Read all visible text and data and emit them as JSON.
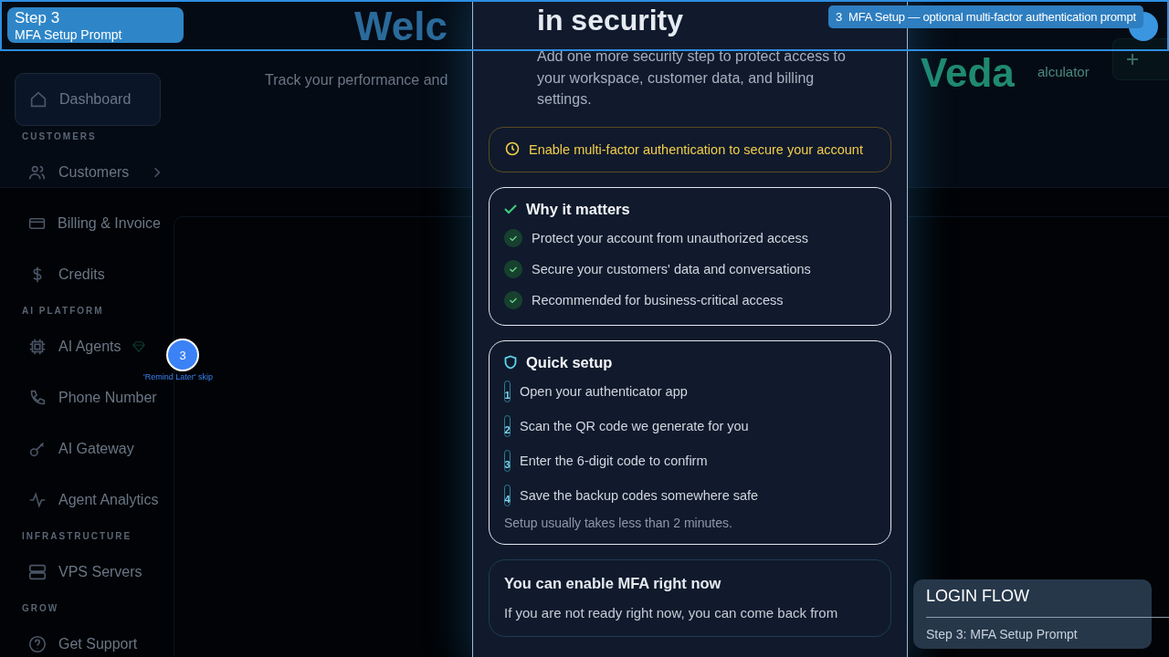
{
  "app": {
    "sidebar": {
      "items": [
        {
          "kind": "item",
          "label": "Dashboard",
          "selected": true
        },
        {
          "kind": "section",
          "label": "CUSTOMERS"
        },
        {
          "kind": "item",
          "label": "Customers",
          "selected": false,
          "expandable": true
        },
        {
          "kind": "item",
          "label": "Billing & Invoice",
          "selected": false
        },
        {
          "kind": "item",
          "label": "Credits",
          "selected": false
        },
        {
          "kind": "section",
          "label": "AI PLATFORM"
        },
        {
          "kind": "item",
          "label": "AI Agents",
          "selected": false,
          "premium": true
        },
        {
          "kind": "item",
          "label": "Phone Number",
          "selected": false
        },
        {
          "kind": "item",
          "label": "AI Gateway",
          "selected": false
        },
        {
          "kind": "item",
          "label": "Agent Analytics",
          "selected": false
        },
        {
          "kind": "section",
          "label": "INFRASTRUCTURE"
        },
        {
          "kind": "item",
          "label": "VPS Servers",
          "selected": false
        },
        {
          "kind": "section",
          "label": "GROW"
        },
        {
          "kind": "item",
          "label": "Get Support",
          "selected": false
        }
      ]
    },
    "header": {
      "subtitle": "Track your performance and",
      "hero_left": "Welc",
      "hero_right": "Veda",
      "link": "alculator"
    }
  },
  "modal": {
    "title": "in security",
    "subtitle": "Add one more security step to protect access to your workspace, customer data, and billing settings.",
    "alert": "Enable multi-factor authentication to secure your account",
    "why": {
      "title": "Why it matters",
      "items": [
        "Protect your account from unauthorized access",
        "Secure your customers' data and conversations",
        "Recommended for business-critical access"
      ]
    },
    "setup": {
      "title": "Quick setup",
      "steps": [
        {
          "number": "1",
          "text": "Open your authenticator app"
        },
        {
          "number": "2",
          "text": "Scan the QR code we generate for you"
        },
        {
          "number": "3",
          "text": "Enter the 6-digit code to confirm"
        },
        {
          "number": "4",
          "text": "Save the backup codes somewhere safe"
        }
      ],
      "note": "Setup usually takes less than 2 minutes."
    },
    "now": {
      "title": "You can enable MFA right now",
      "text": "If you are not ready right now, you can come back from"
    }
  },
  "tour": {
    "banner": {
      "step": "Step 3",
      "title": "MFA Setup Prompt"
    },
    "caption": {
      "number": "3",
      "text": "MFA Setup — optional multi-factor authentication prompt"
    },
    "hotspot": {
      "number": "3",
      "label": "'Remind Later' skip"
    },
    "flow_panel": {
      "title": "LOGIN FLOW",
      "step": "Step 3: MFA Setup Prompt"
    }
  }
}
